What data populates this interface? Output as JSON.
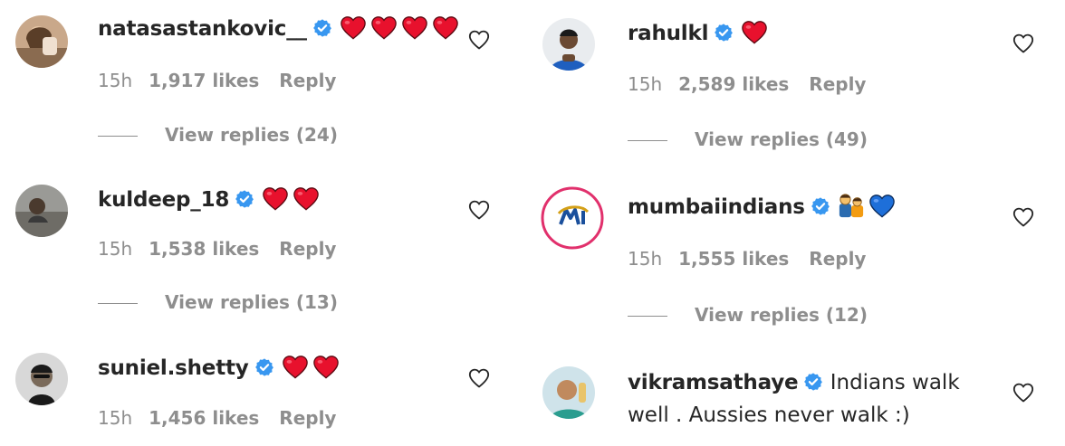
{
  "left_column": [
    {
      "username": "natasastankovic__",
      "avatar": "avatar-natasa",
      "emoji": [
        "red-heart",
        "red-heart",
        "red-heart",
        "red-heart"
      ],
      "text": "",
      "time": "15h",
      "likes": "1,917 likes",
      "reply": "Reply",
      "view_replies": "View replies (24)"
    },
    {
      "username": "kuldeep_18",
      "avatar": "avatar-kuldeep",
      "emoji": [
        "red-heart",
        "red-heart"
      ],
      "text": "",
      "time": "15h",
      "likes": "1,538 likes",
      "reply": "Reply",
      "view_replies": "View replies (13)"
    },
    {
      "username": "suniel.shetty",
      "avatar": "avatar-suniel",
      "emoji": [
        "red-heart",
        "red-heart"
      ],
      "text": "",
      "time": "15h",
      "likes": "1,456 likes",
      "reply": "Reply",
      "view_replies": ""
    }
  ],
  "right_column": [
    {
      "username": "rahulkl",
      "avatar": "avatar-rahul",
      "emoji": [
        "red-heart"
      ],
      "text": "",
      "time": "15h",
      "likes": "2,589 likes",
      "reply": "Reply",
      "view_replies": "View replies (49)"
    },
    {
      "username": "mumbaiindians",
      "avatar": "avatar-mumbaiindians",
      "emoji": [
        "family-emoji",
        "blue-heart"
      ],
      "text": "",
      "time": "15h",
      "likes": "1,555 likes",
      "reply": "Reply",
      "view_replies": "View replies (12)"
    },
    {
      "username": "vikramsathaye",
      "avatar": "avatar-vikram",
      "emoji": [],
      "text_line1": "Indians walk",
      "text_line2": "well . Aussies never walk :)",
      "time": "",
      "likes": "",
      "reply": "",
      "view_replies": ""
    }
  ],
  "colors": {
    "verified_blue": "#3897f0",
    "heart_red": "#e8112d",
    "blue_heart": "#1e6fd9",
    "secondary_text": "#8e8e8e",
    "primary_text": "#262626",
    "mi_ring": "#e1306c"
  }
}
